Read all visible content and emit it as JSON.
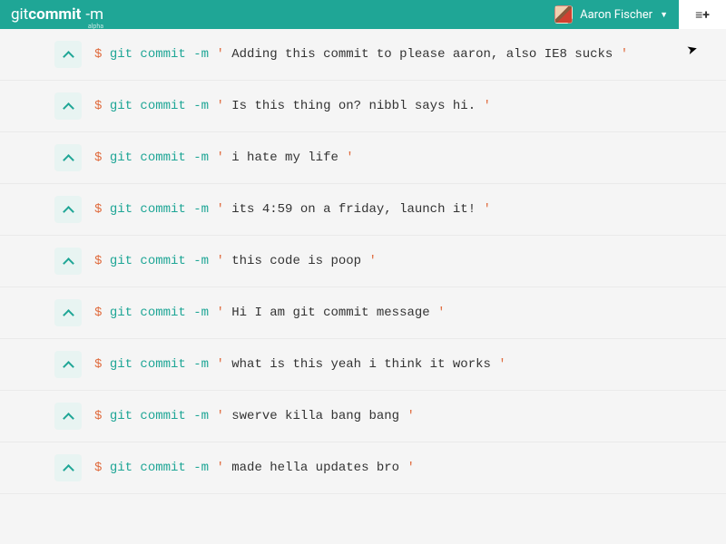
{
  "header": {
    "logo": {
      "git": "git",
      "commit": "commit",
      "flag": "-m",
      "alpha": "alpha"
    },
    "user": {
      "name": "Aaron Fischer"
    },
    "menu_icon": "≡+"
  },
  "commit_parts": {
    "prompt": "$",
    "command": "git commit -m",
    "quote": "'"
  },
  "commits": [
    {
      "message": "Adding this commit to please aaron, also IE8 sucks"
    },
    {
      "message": "Is this thing on? nibbl says hi."
    },
    {
      "message": "i hate my life"
    },
    {
      "message": "its 4:59 on a friday, launch it!"
    },
    {
      "message": "this code is poop"
    },
    {
      "message": "Hi I am git commit message"
    },
    {
      "message": "what is this yeah i think it works"
    },
    {
      "message": "swerve killa bang bang"
    },
    {
      "message": "made hella updates bro"
    }
  ]
}
